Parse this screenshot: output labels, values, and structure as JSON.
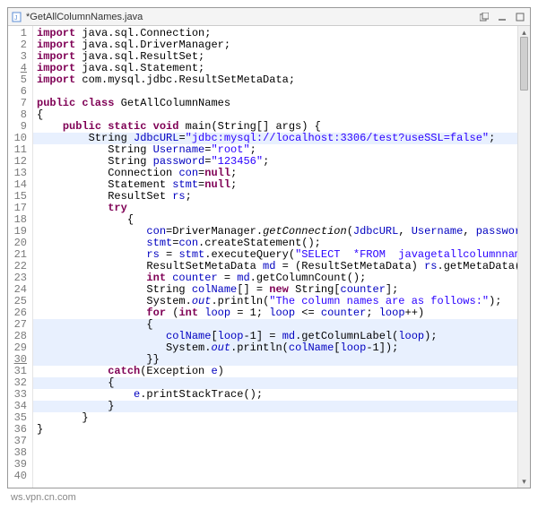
{
  "titlebar": {
    "filename": "*GetAllColumnNames.java",
    "icons": {
      "file": "java-file-icon",
      "restore": "restore-icon",
      "minimize": "minimize-icon",
      "maximize": "maximize-icon"
    }
  },
  "gutter": {
    "underlined": [
      4,
      30
    ]
  },
  "colors": {
    "keyword": "#7f0055",
    "string": "#2a00ff",
    "field": "#0000c0",
    "highlight": "#e8f0fe"
  },
  "highlighted_lines": [
    10,
    27,
    28,
    29,
    30,
    32,
    34
  ],
  "code": {
    "l1": {
      "pre": "",
      "kw": "import",
      "rest": " java.sql.Connection;"
    },
    "l2": {
      "pre": "",
      "kw": "import",
      "rest": " java.sql.DriverManager;"
    },
    "l3": {
      "pre": "",
      "kw": "import",
      "rest": " java.sql.ResultSet;"
    },
    "l4": {
      "pre": "",
      "kw": "import",
      "rest": " java.sql.Statement;"
    },
    "l5": {
      "pre": "",
      "kw": "import",
      "rest": " com.mysql.jdbc.ResultSetMetaData;"
    },
    "l6": {
      "blank": " "
    },
    "l7": {
      "kw1": "public class",
      "cls": " GetAllColumnNames"
    },
    "l8": {
      "txt": "{"
    },
    "l9": {
      "pre": "    ",
      "kw": "public static void",
      "sig": " main(String[] args) {"
    },
    "l10": {
      "pre": "        ",
      "a": "String ",
      "b": "JdbcURL",
      "c": "=",
      "d": "\"jdbc:mysql://localhost:3306/test?useSSL=false\"",
      "e": ";"
    },
    "l11": {
      "pre": "           ",
      "a": "String ",
      "b": "Username",
      "c": "=",
      "d": "\"root\"",
      "e": ";"
    },
    "l12": {
      "pre": "           ",
      "a": "String ",
      "b": "password",
      "c": "=",
      "d": "\"123456\"",
      "e": ";"
    },
    "l13": {
      "pre": "           ",
      "a": "Connection ",
      "b": "con",
      "c": "=",
      "kw": "null",
      "e": ";"
    },
    "l14": {
      "pre": "           ",
      "a": "Statement ",
      "b": "stmt",
      "c": "=",
      "kw": "null",
      "e": ";"
    },
    "l15": {
      "pre": "           ",
      "a": "ResultSet ",
      "b": "rs",
      "e": ";"
    },
    "l17": {
      "pre": "           ",
      "kw": "try"
    },
    "l18": {
      "pre": "              ",
      "txt": "{"
    },
    "l19": {
      "pre": "                 ",
      "b": "con",
      "c": "=DriverManager.",
      "m": "getConnection",
      "d": "(",
      "p1": "JdbcURL",
      "sep1": ", ",
      "p2": "Username",
      "sep2": ", ",
      "p3": "password",
      "end": ");"
    },
    "l20": {
      "pre": "                 ",
      "b": "stmt",
      "c": "=",
      "p1": "con",
      "d": ".createStatement();"
    },
    "l21": {
      "pre": "                 ",
      "b": "rs",
      "c": " = ",
      "p1": "stmt",
      "d": ".executeQuery(",
      "s": "\"SELECT  *FROM  javagetallcolumnnames\"",
      "end": ");"
    },
    "l22": {
      "pre": "                 ",
      "a": "ResultSetMetaData ",
      "b": "md",
      "c": " = (ResultSetMetaData) ",
      "p1": "rs",
      "d": ".getMetaData();"
    },
    "l23": {
      "pre": "                 ",
      "kw": "int",
      "a": " ",
      "b": "counter",
      "c": " = ",
      "p1": "md",
      "d": ".getColumnCount();"
    },
    "l24": {
      "pre": "                 ",
      "a": "String ",
      "b": "colName",
      "c": "[] = ",
      "kw": "new",
      "d": " String[",
      "p1": "counter",
      "end": "];"
    },
    "l25": {
      "pre": "                 ",
      "a": "System.",
      "f": "out",
      "d": ".println(",
      "s": "\"The column names are as follows:\"",
      "end": ");"
    },
    "l26": {
      "pre": "                 ",
      "kw": "for",
      "a": " (",
      "kw2": "int",
      "b": " loop",
      "c": " = 1; ",
      "p1": "loop",
      "d": " <= ",
      "p2": "counter",
      "e": "; ",
      "p3": "loop",
      "end": "++)"
    },
    "l27": {
      "pre": "                 {",
      "txt": ""
    },
    "l28": {
      "pre": "                    ",
      "b": "colName",
      "c": "[",
      "p1": "loop",
      "d": "-1] = ",
      "p2": "md",
      "e": ".getColumnLabel(",
      "p3": "loop",
      "end": ");"
    },
    "l29": {
      "pre": "                    ",
      "a": "System.",
      "f": "out",
      "d": ".println(",
      "p1": "colName",
      "e": "[",
      "p2": "loop",
      "end": "-1]);"
    },
    "l30": {
      "pre": "                 }}",
      "txt": ""
    },
    "l31": {
      "pre": "           ",
      "kw": "catch",
      "a": "(Exception ",
      "b": "e",
      "end": ")"
    },
    "l32": {
      "pre": "           {",
      "txt": ""
    },
    "l33": {
      "pre": "               ",
      "b": "e",
      "d": ".printStackTrace();"
    },
    "l34": {
      "pre": "           }",
      "txt": ""
    },
    "l35": {
      "pre": "       }",
      "txt": ""
    },
    "l36": {
      "pre": "}",
      "txt": ""
    }
  },
  "footer": {
    "url": "ws.vpn.cn.com"
  }
}
